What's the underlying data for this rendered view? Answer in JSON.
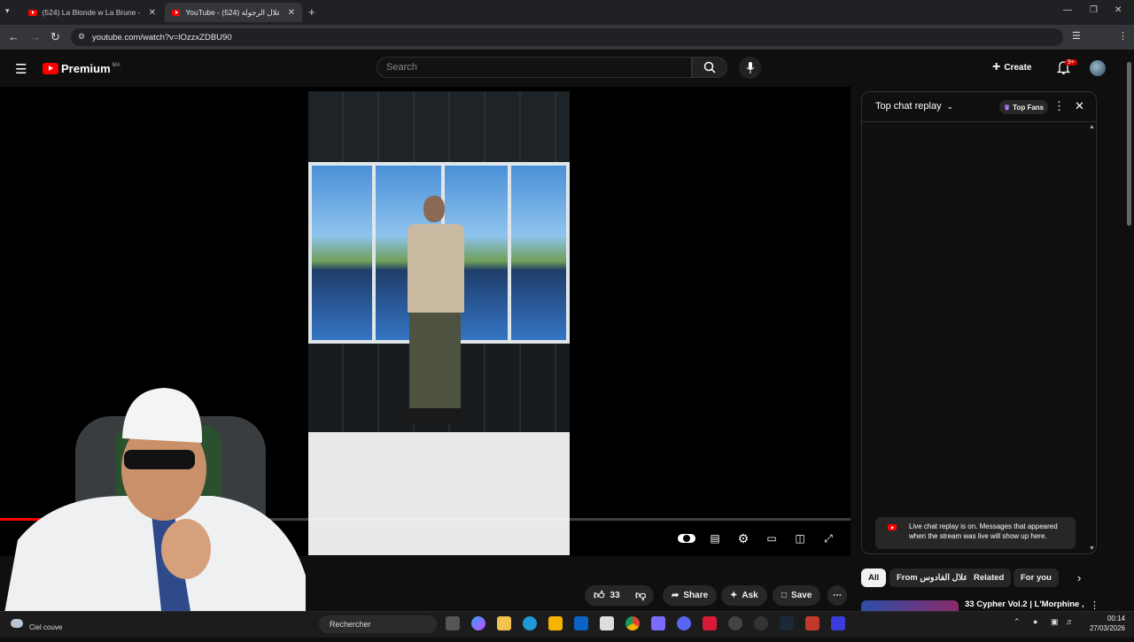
{
  "browser": {
    "tabs": [
      {
        "label": "(524) La Blonde w La Brune - Yo"
      },
      {
        "label": "YouTube - علال الرجولة (524)"
      }
    ],
    "new_tab": "+",
    "url": "youtube.com/watch?v=lOzzxZDBU90"
  },
  "youtube": {
    "logo_text": "Premium",
    "logo_sup": "MA",
    "search_placeholder": "Search",
    "create_label": "Create",
    "notif_badge": "9+"
  },
  "player": {
    "progress_fraction": 0.05
  },
  "chat": {
    "title": "Top chat replay",
    "top_fans": "Top Fans",
    "notice": "Live chat replay is on. Messages that appeared when the stream was live will show up here."
  },
  "chips": [
    "All",
    "From علال الفادوس",
    "Related",
    "For you"
  ],
  "actions": {
    "like_count": "33",
    "share": "Share",
    "ask": "Ask",
    "save": "Save"
  },
  "related": {
    "first_title": "33 Cypher Vol.2 | L'Morphine ,"
  },
  "taskbar": {
    "weather": "Ciel couve",
    "search": "Rechercher",
    "time": "00:14",
    "date": "27/03/2026"
  },
  "colors": {
    "brand_red": "#ff0000",
    "bg": "#0f0f0f"
  }
}
